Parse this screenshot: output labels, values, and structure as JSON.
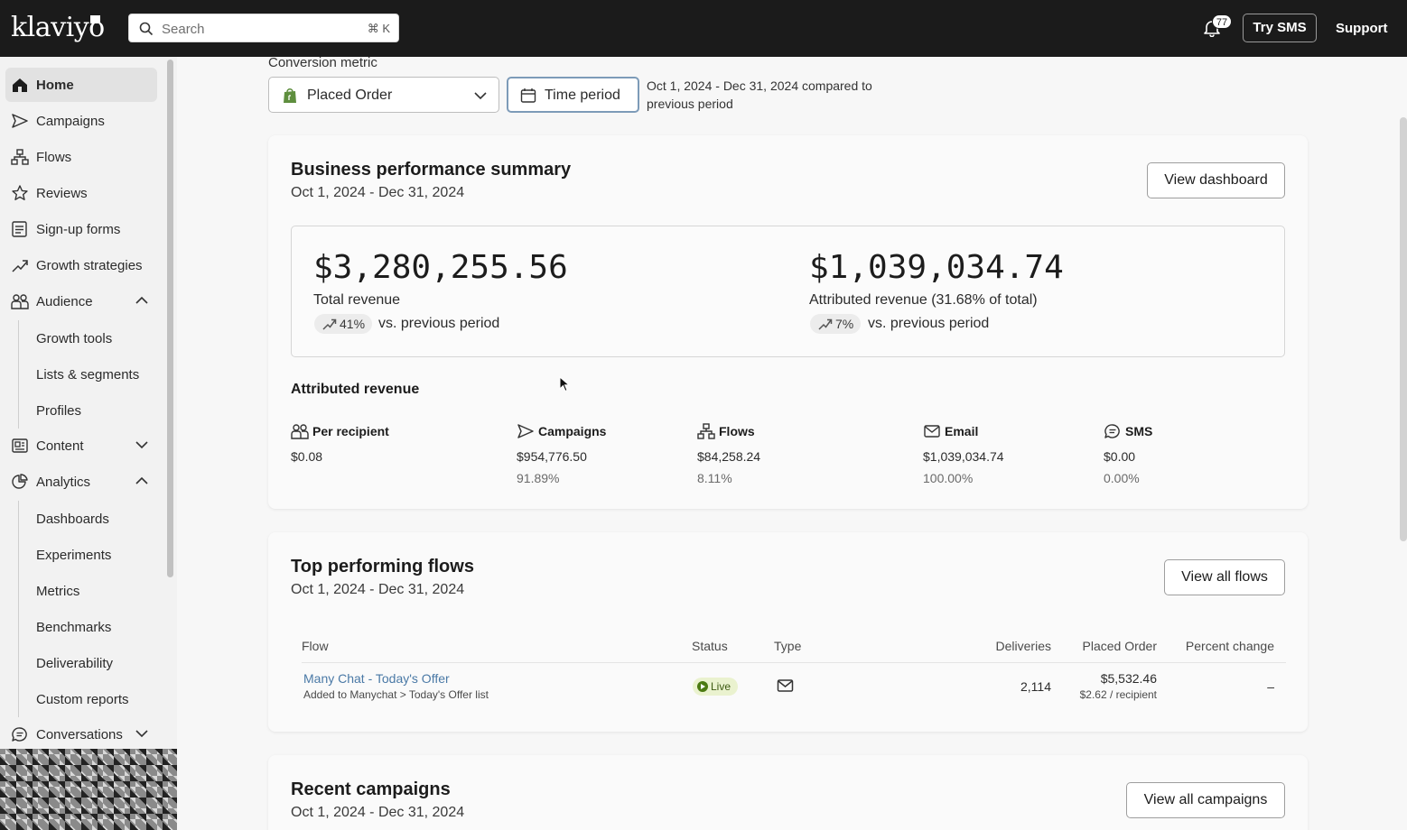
{
  "topbar": {
    "logo": "klaviyo",
    "search_placeholder": "Search",
    "search_shortcut": "⌘ K",
    "notification_count": "77",
    "try_sms": "Try SMS",
    "support": "Support"
  },
  "sidebar": {
    "items": [
      {
        "label": "Home"
      },
      {
        "label": "Campaigns"
      },
      {
        "label": "Flows"
      },
      {
        "label": "Reviews"
      },
      {
        "label": "Sign-up forms"
      },
      {
        "label": "Growth strategies"
      },
      {
        "label": "Audience"
      },
      {
        "label": "Content"
      },
      {
        "label": "Analytics"
      },
      {
        "label": "Conversations"
      }
    ],
    "audience_sub": [
      "Growth tools",
      "Lists & segments",
      "Profiles"
    ],
    "analytics_sub": [
      "Dashboards",
      "Experiments",
      "Metrics",
      "Benchmarks",
      "Deliverability",
      "Custom reports"
    ]
  },
  "filters": {
    "conversion_label": "Conversion metric",
    "conversion_value": "Placed Order",
    "time_period": "Time period",
    "period_text": "Oct 1, 2024 - Dec 31, 2024 compared to previous period"
  },
  "summary": {
    "title": "Business performance summary",
    "date": "Oct 1, 2024 - Dec 31, 2024",
    "view_button": "View dashboard",
    "total_revenue": "$3,280,255.56",
    "total_label": "Total revenue",
    "total_change": "41%",
    "attributed_revenue": "$1,039,034.74",
    "attributed_label": "Attributed revenue (31.68% of total)",
    "attributed_change": "7%",
    "vs_text": "vs. previous period",
    "attributed_heading": "Attributed revenue",
    "metrics": [
      {
        "label": "Per recipient",
        "value": "$0.08",
        "pct": ""
      },
      {
        "label": "Campaigns",
        "value": "$954,776.50",
        "pct": "91.89%"
      },
      {
        "label": "Flows",
        "value": "$84,258.24",
        "pct": "8.11%"
      },
      {
        "label": "Email",
        "value": "$1,039,034.74",
        "pct": "100.00%"
      },
      {
        "label": "SMS",
        "value": "$0.00",
        "pct": "0.00%"
      }
    ]
  },
  "flows": {
    "title": "Top performing flows",
    "date": "Oct 1, 2024 - Dec 31, 2024",
    "view_button": "View all flows",
    "columns": [
      "Flow",
      "Status",
      "Type",
      "Deliveries",
      "Placed Order",
      "Percent change"
    ],
    "rows": [
      {
        "name": "Many Chat - Today's Offer",
        "desc": "Added to Manychat > Today's Offer list",
        "status": "Live",
        "type_icon": "email-icon",
        "deliveries": "2,114",
        "placed_order": "$5,532.46",
        "per_recipient": "$2.62 / recipient",
        "percent_change": "–"
      }
    ]
  },
  "campaigns": {
    "title": "Recent campaigns",
    "date": "Oct 1, 2024 - Dec 31, 2024",
    "view_button": "View all campaigns"
  },
  "colors": {
    "topbar": "#1b1b1b",
    "link": "#4a79a6",
    "live_badge_bg": "#eaf2cf",
    "live_badge_fg": "#3d5a12"
  }
}
